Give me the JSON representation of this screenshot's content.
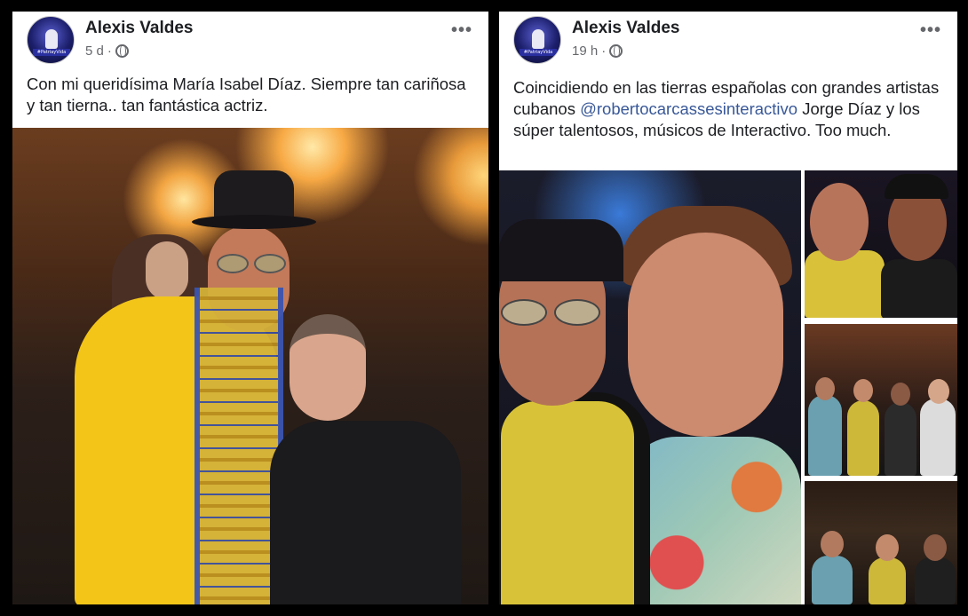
{
  "left_post": {
    "author": "Alexis Valdes",
    "time": "5 d",
    "separator": "·",
    "text": "Con mi queridísima María Isabel Díaz. Siempre tan cariñosa y tan tierna.. tan fantástica actriz.",
    "more": "•••",
    "avatar_tag": "#PatriayVida"
  },
  "right_post": {
    "author": "Alexis Valdes",
    "time": "19 h",
    "separator": "·",
    "text_before": "Coincidiendo en las tierras españolas con grandes artistas cubanos ",
    "mention": "@robertocarcassesinteractivo",
    "text_after": " Jorge Díaz y los súper talentosos, músicos de Interactivo. Too much.",
    "more": "•••",
    "avatar_tag": "#PatriayVida"
  },
  "colors": {
    "background": "#000000",
    "card": "#ffffff",
    "text": "#1c1e21",
    "meta": "#65676b",
    "mention": "#385898"
  },
  "icons": [
    "globe-icon",
    "more-options-icon"
  ]
}
